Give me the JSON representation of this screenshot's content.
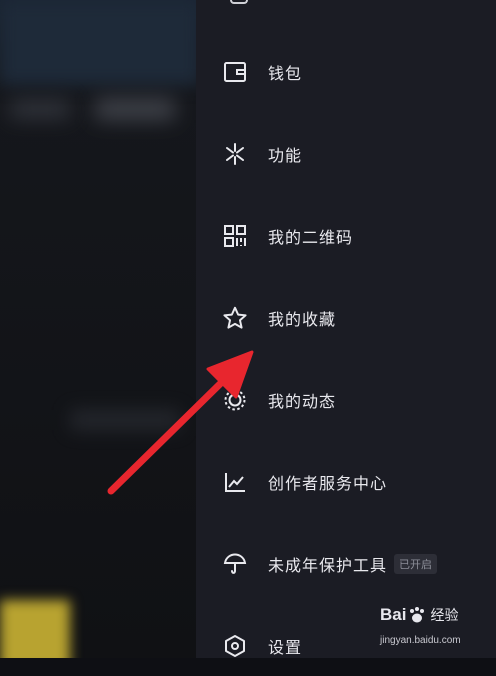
{
  "menu": {
    "items": [
      {
        "label": "钱包",
        "icon": "wallet-icon"
      },
      {
        "label": "功能",
        "icon": "sparkle-icon"
      },
      {
        "label": "我的二维码",
        "icon": "qr-code-icon"
      },
      {
        "label": "我的收藏",
        "icon": "star-icon"
      },
      {
        "label": "我的动态",
        "icon": "activity-circle-icon"
      },
      {
        "label": "创作者服务中心",
        "icon": "chart-line-icon"
      },
      {
        "label": "未成年保护工具",
        "icon": "umbrella-icon",
        "badge": "已开启"
      },
      {
        "label": "设置",
        "icon": "settings-hexagon-icon"
      }
    ]
  },
  "colors": {
    "drawer_background": "#1b1c24",
    "text": "#e9e9ee",
    "arrow": "#e8262e"
  },
  "watermark": {
    "brand": "Bai",
    "brand_suffix": "经验",
    "url": "jingyan.baidu.com"
  }
}
